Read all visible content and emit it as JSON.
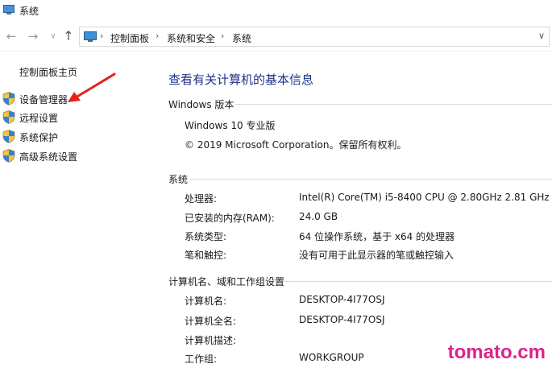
{
  "window": {
    "title": "系统"
  },
  "nav": {
    "back_icon": "back-arrow-icon",
    "forward_icon": "forward-arrow-icon",
    "up_icon": "up-arrow-icon"
  },
  "address": {
    "crumbs": [
      "控制面板",
      "系统和安全",
      "系统"
    ]
  },
  "sidebar": {
    "home": "控制面板主页",
    "items": [
      {
        "label": "设备管理器",
        "icon": "shield-icon"
      },
      {
        "label": "远程设置",
        "icon": "shield-icon"
      },
      {
        "label": "系统保护",
        "icon": "shield-icon"
      },
      {
        "label": "高级系统设置",
        "icon": "shield-icon"
      }
    ]
  },
  "main": {
    "title": "查看有关计算机的基本信息",
    "windows_edition": {
      "heading": "Windows 版本",
      "edition": "Windows 10 专业版",
      "copyright": "© 2019 Microsoft Corporation。保留所有权利。"
    },
    "system": {
      "heading": "系统",
      "rows": [
        {
          "label": "处理器:",
          "value": "Intel(R) Core(TM) i5-8400 CPU @ 2.80GHz   2.81 GHz"
        },
        {
          "label": "已安装的内存(RAM):",
          "value": "24.0 GB"
        },
        {
          "label": "系统类型:",
          "value": "64 位操作系统，基于 x64 的处理器"
        },
        {
          "label": "笔和触控:",
          "value": "没有可用于此显示器的笔或触控输入"
        }
      ]
    },
    "computer": {
      "heading": "计算机名、域和工作组设置",
      "rows": [
        {
          "label": "计算机名:",
          "value": "DESKTOP-4I77OSJ"
        },
        {
          "label": "计算机全名:",
          "value": "DESKTOP-4I77OSJ"
        },
        {
          "label": "计算机描述:",
          "value": ""
        },
        {
          "label": "工作组:",
          "value": "WORKGROUP"
        }
      ]
    }
  },
  "watermark": "tomato.cm",
  "colors": {
    "title": "#1e3287",
    "annotation_arrow": "#e0241b",
    "watermark": "#e0218a"
  }
}
